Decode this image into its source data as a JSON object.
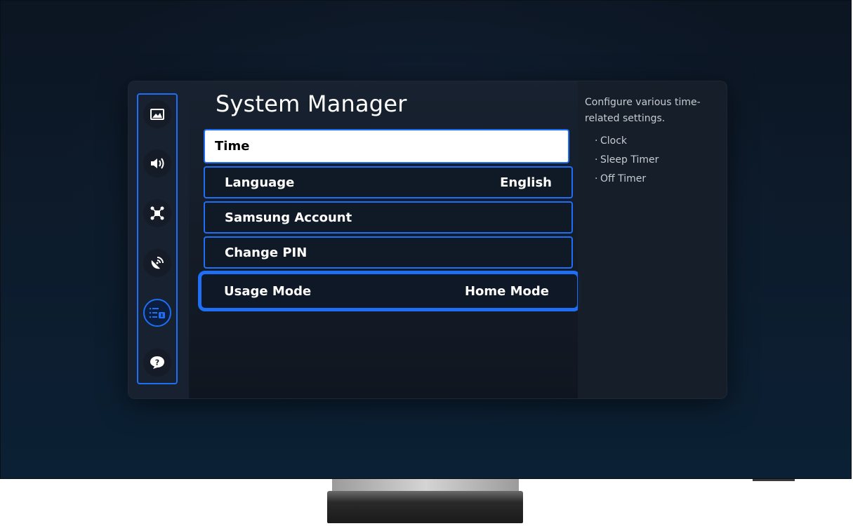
{
  "header": {
    "title": "System Manager"
  },
  "sidebar": {
    "items": [
      {
        "name": "picture",
        "icon": "picture-icon",
        "active": false
      },
      {
        "name": "sound",
        "icon": "sound-icon",
        "active": false
      },
      {
        "name": "connection",
        "icon": "connection-icon",
        "active": false
      },
      {
        "name": "broadcasting",
        "icon": "broadcast-icon",
        "active": false
      },
      {
        "name": "general",
        "icon": "general-list-icon",
        "active": true
      },
      {
        "name": "support",
        "icon": "support-icon",
        "active": false
      }
    ]
  },
  "menu": {
    "items": [
      {
        "label": "Time",
        "value": "",
        "state": "selected"
      },
      {
        "label": "Language",
        "value": "English",
        "state": "normal"
      },
      {
        "label": "Samsung Account",
        "value": "",
        "state": "normal"
      },
      {
        "label": "Change PIN",
        "value": "",
        "state": "normal"
      },
      {
        "label": "Usage Mode",
        "value": "Home Mode",
        "state": "highlighted"
      }
    ]
  },
  "info": {
    "description": "Configure various time-related settings.",
    "bullets": [
      "Clock",
      "Sleep Timer",
      "Off Timer"
    ]
  },
  "colors": {
    "accent": "#1e6ff5",
    "background": "#0d1b2b",
    "panel": "#141c28",
    "selected_bg": "#ffffff"
  }
}
